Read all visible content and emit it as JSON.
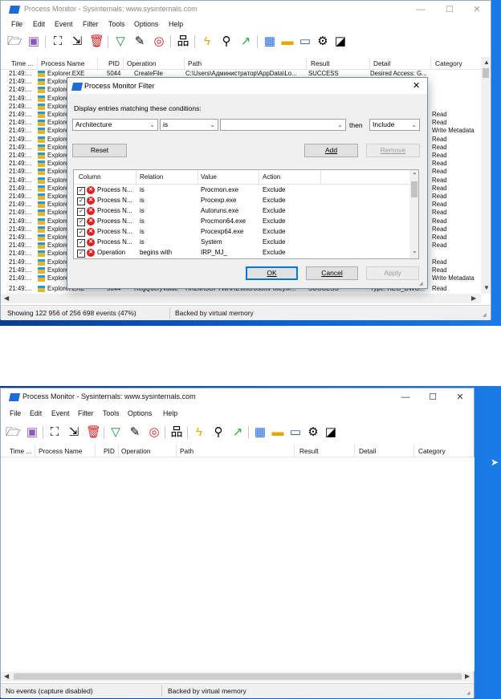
{
  "top": {
    "title": "Process Monitor - Sysinternals: www.sysinternals.com",
    "menu": [
      "File",
      "Edit",
      "Event",
      "Filter",
      "Tools",
      "Options",
      "Help"
    ],
    "columns": [
      "Time ...",
      "Process Name",
      "PID",
      "Operation",
      "Path",
      "Result",
      "Detail",
      "Category"
    ],
    "first_row": {
      "time": "21:49:...",
      "process": "Explorer.EXE",
      "pid": "5044",
      "operation": "CreateFile",
      "path": "C:\\Users\\Администратор\\AppData\\Lo...",
      "result": "SUCCESS",
      "detail": "Desired Access: G..."
    },
    "last_row": {
      "time": "21:49:...",
      "process": "Explorer.EXE",
      "pid": "5044",
      "operation": "RegQueryValue",
      "path": "HKLM\\SOFTWARE\\Microsoft\\PolicyM...",
      "result": "SUCCESS",
      "detail": "Type: REG_DWO...",
      "category": "Read"
    },
    "row_time": "21:49:...",
    "row_process": "Explorer.EXE",
    "categories": [
      "",
      "",
      "",
      "",
      "",
      "Read",
      "Read",
      "Write Metadata",
      "Read",
      "Read",
      "Read",
      "Read",
      "Read",
      "Read",
      "Read",
      "Read",
      "Read",
      "Read",
      "Read",
      "Read",
      "Read",
      "Read",
      "",
      "Read",
      "Read",
      "Write Metadata",
      "Read"
    ],
    "status_events": "Showing 122 956 of 256 698 events (47%)",
    "status_memory": "Backed by virtual memory"
  },
  "dialog": {
    "title": "Process Monitor Filter",
    "prompt": "Display entries matching these conditions:",
    "column_combo": "Architecture",
    "relation_combo": "is",
    "value_combo": "",
    "then_label": "then",
    "action_combo": "Include",
    "reset_label": "Reset",
    "add_label": "Add",
    "remove_label": "Remove",
    "list_headers": [
      "Column",
      "Relation",
      "Value",
      "Action"
    ],
    "rules": [
      {
        "column": "Process N...",
        "relation": "is",
        "value": "Procmon.exe",
        "action": "Exclude"
      },
      {
        "column": "Process N...",
        "relation": "is",
        "value": "Procexp.exe",
        "action": "Exclude"
      },
      {
        "column": "Process N...",
        "relation": "is",
        "value": "Autoruns.exe",
        "action": "Exclude"
      },
      {
        "column": "Process N...",
        "relation": "is",
        "value": "Procmon64.exe",
        "action": "Exclude"
      },
      {
        "column": "Process N...",
        "relation": "is",
        "value": "Procexp64.exe",
        "action": "Exclude"
      },
      {
        "column": "Process N...",
        "relation": "is",
        "value": "System",
        "action": "Exclude"
      },
      {
        "column": "Operation",
        "relation": "begins with",
        "value": "IRP_MJ_",
        "action": "Exclude"
      }
    ],
    "ok_label": "OK",
    "cancel_label": "Cancel",
    "apply_label": "Apply"
  },
  "bottom": {
    "title": "Process Monitor - Sysinternals: www.sysinternals.com",
    "menu": [
      "File",
      "Edit",
      "Event",
      "Filter",
      "Tools",
      "Options",
      "Help"
    ],
    "columns": [
      "Time ...",
      "Process Name",
      "PID",
      "Operation",
      "Path",
      "Result",
      "Detail",
      "Category"
    ],
    "status_events": "No events (capture disabled)",
    "status_memory": "Backed by virtual memory"
  },
  "icons": [
    "open-folder-icon",
    "save-icon",
    "capture-icon",
    "autoscroll-icon",
    "clear-icon",
    "filter-icon",
    "highlight-icon",
    "target-icon",
    "process-tree-icon",
    "event-icon",
    "find-icon",
    "jump-icon",
    "registry-icon",
    "filesystem-icon",
    "network-icon",
    "process-activity-icon",
    "profiling-icon"
  ],
  "colors": {
    "desktop": "#0d63d6",
    "accent": "#1e6bd8",
    "error_icon": "#e02020"
  }
}
